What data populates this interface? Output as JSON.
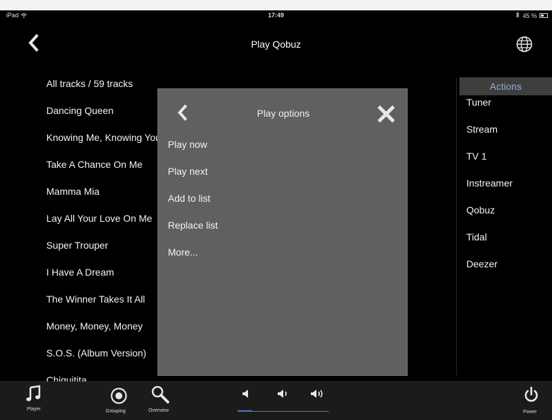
{
  "status": {
    "device": "iPad",
    "time": "17:49",
    "battery": "45 %"
  },
  "header": {
    "title": "Play Qobuz"
  },
  "tracks": [
    "All tracks / 59 tracks",
    "Dancing Queen",
    "Knowing Me, Knowing You",
    "Take A Chance On Me",
    "Mamma Mia",
    "Lay All Your Love On Me",
    "Super Trouper",
    "I Have A Dream",
    "The Winner Takes It All",
    "Money, Money, Money",
    "S.O.S. (Album Version)",
    "Chiquitita"
  ],
  "actions": {
    "header": "Actions",
    "items": [
      "Tuner",
      "Stream",
      "TV 1",
      "Instreamer",
      "Qobuz",
      "Tidal",
      "Deezer"
    ]
  },
  "popup": {
    "title": "Play options",
    "options": [
      "Play now",
      "Play next",
      "Add to list",
      "Replace list",
      "More..."
    ]
  },
  "toolbar": {
    "player_label": "Player",
    "grouping_label": "Grouping",
    "overview_label": "Overview",
    "power_label": "Power",
    "volume_level": 0.16
  },
  "colors": {
    "background": "#000000",
    "popup": "#606060",
    "toolbar": "#1b1b1b",
    "accent": "#4a7fd0",
    "actions_header_text": "#8fb0d8"
  },
  "icons": {
    "back": "chevron-left-icon",
    "globe": "globe-icon",
    "close": "close-icon",
    "player": "music-note-icon",
    "grouping": "record-icon",
    "overview": "search-icon",
    "volume_mute": "speaker-mute-icon",
    "volume_low": "speaker-low-icon",
    "volume_high": "speaker-high-icon",
    "power": "power-icon"
  }
}
